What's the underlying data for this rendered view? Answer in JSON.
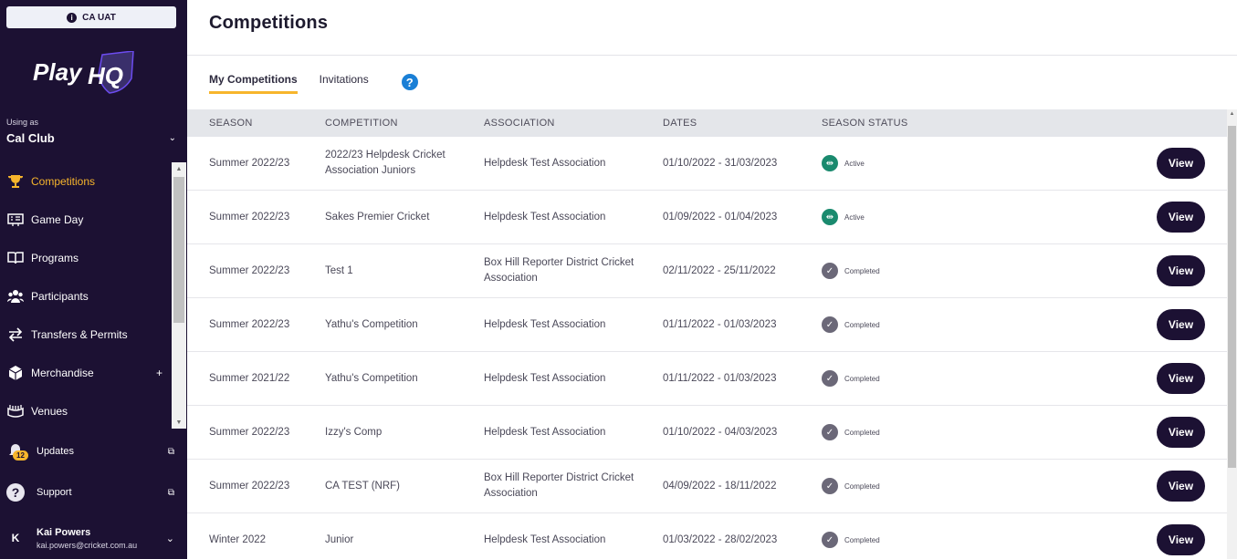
{
  "env": {
    "label": "CA UAT"
  },
  "brand": {
    "name_play": "Play",
    "name_hq": "HQ"
  },
  "org": {
    "using_as_label": "Using as",
    "name": "Cal Club"
  },
  "nav": {
    "items": [
      {
        "label": "Competitions",
        "icon": "trophy-icon",
        "active": true
      },
      {
        "label": "Game Day",
        "icon": "scoreboard-icon"
      },
      {
        "label": "Programs",
        "icon": "book-icon"
      },
      {
        "label": "Participants",
        "icon": "people-icon"
      },
      {
        "label": "Transfers & Permits",
        "icon": "transfer-icon"
      },
      {
        "label": "Merchandise",
        "icon": "box-icon",
        "plus": "+"
      },
      {
        "label": "Venues",
        "icon": "stadium-icon"
      }
    ]
  },
  "updates": {
    "label": "Updates",
    "badge": "12"
  },
  "support": {
    "label": "Support"
  },
  "user": {
    "initial": "K",
    "name": "Kai Powers",
    "email": "kai.powers@cricket.com.au"
  },
  "page": {
    "title": "Competitions"
  },
  "tabs": [
    {
      "label": "My Competitions",
      "active": true
    },
    {
      "label": "Invitations",
      "active": false
    }
  ],
  "help": {
    "label": "?"
  },
  "table": {
    "headers": [
      "SEASON",
      "COMPETITION",
      "ASSOCIATION",
      "DATES",
      "SEASON STATUS"
    ],
    "rows": [
      {
        "season": "Summer 2022/23",
        "competition": "2022/23 Helpdesk Cricket Association Juniors",
        "association": "Helpdesk Test Association",
        "dates": "01/10/2022 - 31/03/2023",
        "status": "Active",
        "action": "View"
      },
      {
        "season": "Summer 2022/23",
        "competition": "Sakes Premier Cricket",
        "association": "Helpdesk Test Association",
        "dates": "01/09/2022 - 01/04/2023",
        "status": "Active",
        "action": "View"
      },
      {
        "season": "Summer 2022/23",
        "competition": "Test 1",
        "association": "Box Hill Reporter District Cricket Association",
        "dates": "02/11/2022 - 25/11/2022",
        "status": "Completed",
        "action": "View"
      },
      {
        "season": "Summer 2022/23",
        "competition": "Yathu's Competition",
        "association": "Helpdesk Test Association",
        "dates": "01/11/2022 - 01/03/2023",
        "status": "Completed",
        "action": "View"
      },
      {
        "season": "Summer 2021/22",
        "competition": "Yathu's Competition",
        "association": "Helpdesk Test Association",
        "dates": "01/11/2022 - 01/03/2023",
        "status": "Completed",
        "action": "View"
      },
      {
        "season": "Summer 2022/23",
        "competition": "Izzy's Comp",
        "association": "Helpdesk Test Association",
        "dates": "01/10/2022 - 04/03/2023",
        "status": "Completed",
        "action": "View"
      },
      {
        "season": "Summer 2022/23",
        "competition": "CA TEST (NRF)",
        "association": "Box Hill Reporter District Cricket Association",
        "dates": "04/09/2022 - 18/11/2022",
        "status": "Completed",
        "action": "View"
      },
      {
        "season": "Winter 2022",
        "competition": "Junior",
        "association": "Helpdesk Test Association",
        "dates": "01/03/2022 - 28/02/2023",
        "status": "Completed",
        "action": "View"
      }
    ]
  },
  "colors": {
    "sidebar": "#1c1133",
    "accent": "#f7b52c",
    "active_status": "#1a8a6e",
    "completed_status": "#6b6878",
    "help": "#1a7fd6"
  }
}
